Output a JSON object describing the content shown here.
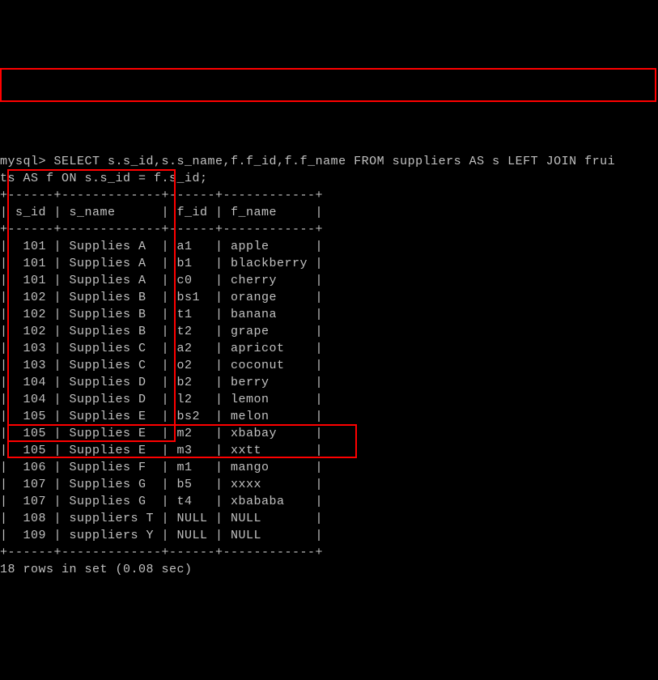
{
  "prompt": "mysql> ",
  "query": "SELECT s.s_id,s.s_name,f.f_id,f.f_name FROM suppliers AS s LEFT JOIN frui\nts AS f ON s.s_id = f.s_id;",
  "separator": "+------+-------------+------+------------+",
  "header": "| s_id | s_name      | f_id | f_name     |",
  "rows": [
    "|  101 | Supplies A  | a1   | apple      |",
    "|  101 | Supplies A  | b1   | blackberry |",
    "|  101 | Supplies A  | c0   | cherry     |",
    "|  102 | Supplies B  | bs1  | orange     |",
    "|  102 | Supplies B  | t1   | banana     |",
    "|  102 | Supplies B  | t2   | grape      |",
    "|  103 | Supplies C  | a2   | apricot    |",
    "|  103 | Supplies C  | o2   | coconut    |",
    "|  104 | Supplies D  | b2   | berry      |",
    "|  104 | Supplies D  | l2   | lemon      |",
    "|  105 | Supplies E  | bs2  | melon      |",
    "|  105 | Supplies E  | m2   | xbabay     |",
    "|  105 | Supplies E  | m3   | xxtt       |",
    "|  106 | Supplies F  | m1   | mango      |",
    "|  107 | Supplies G  | b5   | xxxx       |",
    "|  107 | Supplies G  | t4   | xbababa    |",
    "|  108 | suppliers T | NULL | NULL       |",
    "|  109 | suppliers Y | NULL | NULL       |"
  ],
  "footer": "18 rows in set (0.08 sec)",
  "chart_data": {
    "type": "table",
    "columns": [
      "s_id",
      "s_name",
      "f_id",
      "f_name"
    ],
    "data": [
      [
        101,
        "Supplies A",
        "a1",
        "apple"
      ],
      [
        101,
        "Supplies A",
        "b1",
        "blackberry"
      ],
      [
        101,
        "Supplies A",
        "c0",
        "cherry"
      ],
      [
        102,
        "Supplies B",
        "bs1",
        "orange"
      ],
      [
        102,
        "Supplies B",
        "t1",
        "banana"
      ],
      [
        102,
        "Supplies B",
        "t2",
        "grape"
      ],
      [
        103,
        "Supplies C",
        "a2",
        "apricot"
      ],
      [
        103,
        "Supplies C",
        "o2",
        "coconut"
      ],
      [
        104,
        "Supplies D",
        "b2",
        "berry"
      ],
      [
        104,
        "Supplies D",
        "l2",
        "lemon"
      ],
      [
        105,
        "Supplies E",
        "bs2",
        "melon"
      ],
      [
        105,
        "Supplies E",
        "m2",
        "xbabay"
      ],
      [
        105,
        "Supplies E",
        "m3",
        "xxtt"
      ],
      [
        106,
        "Supplies F",
        "m1",
        "mango"
      ],
      [
        107,
        "Supplies G",
        "b5",
        "xxxx"
      ],
      [
        107,
        "Supplies G",
        "t4",
        "xbababa"
      ],
      [
        108,
        "suppliers T",
        null,
        null
      ],
      [
        109,
        "suppliers Y",
        null,
        null
      ]
    ]
  }
}
